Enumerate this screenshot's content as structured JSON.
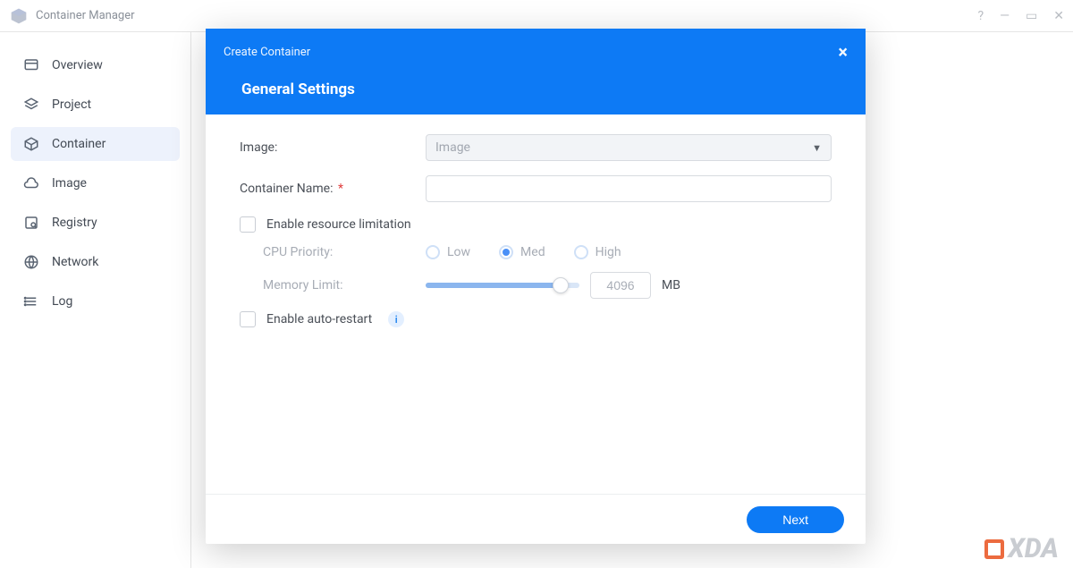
{
  "app": {
    "title": "Container Manager"
  },
  "sidebar": {
    "items": [
      {
        "label": "Overview",
        "icon": "overview"
      },
      {
        "label": "Project",
        "icon": "project"
      },
      {
        "label": "Container",
        "icon": "container",
        "active": true
      },
      {
        "label": "Image",
        "icon": "image"
      },
      {
        "label": "Registry",
        "icon": "registry"
      },
      {
        "label": "Network",
        "icon": "network"
      },
      {
        "label": "Log",
        "icon": "log"
      }
    ]
  },
  "modal": {
    "breadcrumb": "Create Container",
    "title": "General Settings",
    "fields": {
      "image_label": "Image:",
      "image_placeholder": "Image",
      "container_name_label": "Container Name:",
      "container_name_required": "*",
      "container_name_value": "",
      "enable_resource_limitation_label": "Enable resource limitation",
      "enable_resource_limitation_checked": false,
      "cpu_priority_label": "CPU Priority:",
      "cpu_priority_options": {
        "low": "Low",
        "med": "Med",
        "high": "High"
      },
      "cpu_priority_selected": "med",
      "memory_limit_label": "Memory Limit:",
      "memory_limit_value": "4096",
      "memory_limit_unit": "MB",
      "enable_auto_restart_label": "Enable auto-restart",
      "enable_auto_restart_checked": false
    },
    "footer": {
      "next": "Next"
    }
  },
  "watermark": "XDA"
}
